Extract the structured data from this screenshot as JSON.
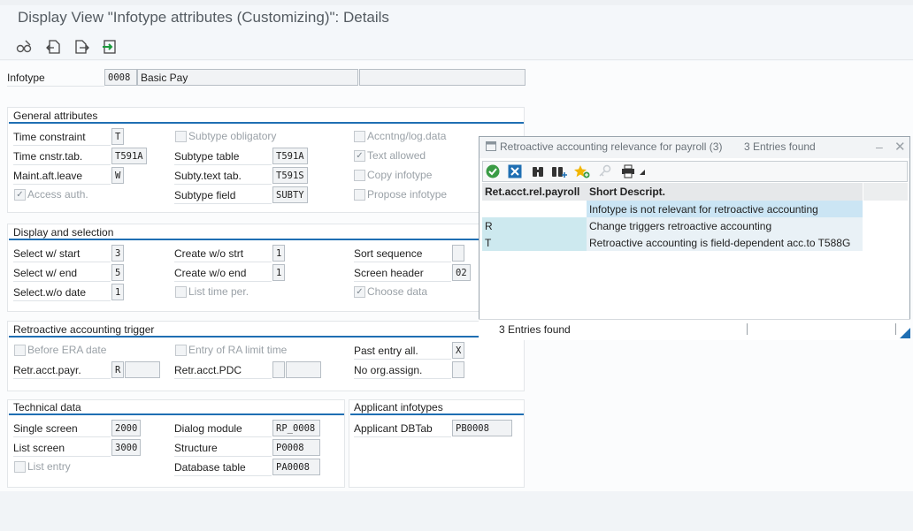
{
  "window": {
    "title": "Display View \"Infotype attributes (Customizing)\": Details"
  },
  "toolbar": {
    "icons": [
      "glasses-edit-icon",
      "previous-entry-icon",
      "next-entry-icon",
      "export-icon"
    ]
  },
  "infotype": {
    "label": "Infotype",
    "code": "0008",
    "name": "Basic Pay"
  },
  "general": {
    "title": "General attributes",
    "time_constraint_label": "Time constraint",
    "time_constraint_value": "T",
    "time_cnstr_tab_label": "Time cnstr.tab.",
    "time_cnstr_tab_value": "T591A",
    "maint_aft_leave_label": "Maint.aft.leave",
    "maint_aft_leave_value": "W",
    "access_auth_label": "Access auth.",
    "access_auth_checked": true,
    "subtype_obligatory_label": "Subtype obligatory",
    "subtype_table_label": "Subtype table",
    "subtype_table_value": "T591A",
    "subty_text_tab_label": "Subty.text tab.",
    "subty_text_tab_value": "T591S",
    "subtype_field_label": "Subtype field",
    "subtype_field_value": "SUBTY",
    "accntng_label": "Accntng/log.data",
    "text_allowed_label": "Text allowed",
    "text_allowed_checked": true,
    "copy_infotype_label": "Copy infotype",
    "propose_infotype_label": "Propose infotype"
  },
  "display": {
    "title": "Display and selection",
    "select_start_label": "Select w/ start",
    "select_start_value": "3",
    "select_end_label": "Select w/ end",
    "select_end_value": "5",
    "select_wo_date_label": "Select.w/o date",
    "select_wo_date_value": "1",
    "create_wo_strt_label": "Create w/o strt",
    "create_wo_strt_value": "1",
    "create_wo_end_label": "Create w/o end",
    "create_wo_end_value": "1",
    "list_time_per_label": "List time per.",
    "sort_sequence_label": "Sort sequence",
    "sort_sequence_value": "",
    "screen_header_label": "Screen header",
    "screen_header_value": "02",
    "choose_data_label": "Choose data",
    "choose_data_checked": true
  },
  "retro": {
    "title": "Retroactive accounting trigger",
    "before_era_label": "Before ERA date",
    "retr_acct_payr_label": "Retr.acct.payr.",
    "retr_acct_payr_value": "R",
    "entry_ra_label": "Entry of RA limit time",
    "retr_acct_pdc_label": "Retr.acct.PDC",
    "past_entry_label": "Past entry all.",
    "past_entry_value": "X",
    "no_org_assign_label": "No org.assign."
  },
  "technical": {
    "title": "Technical data",
    "single_screen_label": "Single screen",
    "single_screen_value": "2000",
    "list_screen_label": "List screen",
    "list_screen_value": "3000",
    "list_entry_label": "List entry",
    "dialog_module_label": "Dialog module",
    "dialog_module_value": "RP_0008",
    "structure_label": "Structure",
    "structure_value": "P0008",
    "database_table_label": "Database table",
    "database_table_value": "PA0008"
  },
  "applicant": {
    "title": "Applicant infotypes",
    "applicant_dbtab_label": "Applicant DBTab",
    "applicant_dbtab_value": "PB0008"
  },
  "popup": {
    "title": "Retroactive accounting relevance for payroll (3)",
    "entries_found": "3 Entries found",
    "col1": "Ret.acct.rel.payroll",
    "col2": "Short Descript.",
    "rows": [
      {
        "key": "",
        "desc": "Infotype is not relevant for retroactive accounting"
      },
      {
        "key": "R",
        "desc": "Change triggers retroactive accounting"
      },
      {
        "key": "T",
        "desc": "Retroactive accounting is field-dependent acc.to T588G"
      }
    ],
    "status_text": "3 Entries found",
    "colors": {
      "selected": "#cbe5f4",
      "key_cell": "#cde9ef"
    }
  }
}
